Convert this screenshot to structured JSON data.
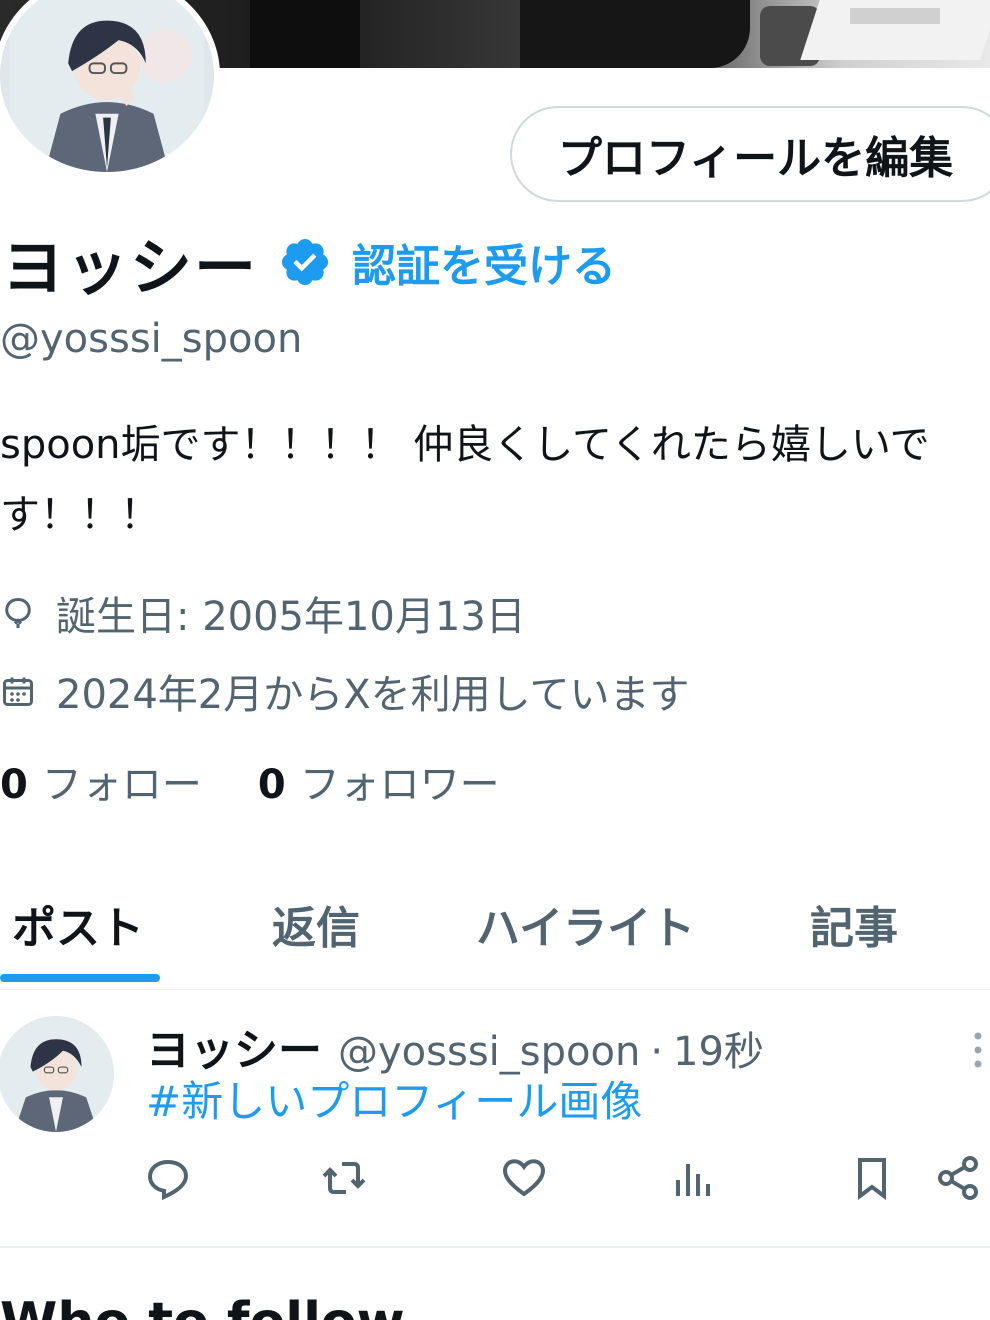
{
  "profile": {
    "display_name": "ヨッシー",
    "verify_link": "認証を受ける",
    "handle": "@yosssi_spoon",
    "bio": "spoon垢です！！！！ 仲良くしてくれたら嬉しいです！！！",
    "birthday": "誕生日: 2005年10月13日",
    "joined": "2024年2月からXを利用しています",
    "following_count": "0",
    "following_label": "フォロー",
    "followers_count": "0",
    "followers_label": "フォロワー",
    "edit_button": "プロフィールを編集"
  },
  "tabs": [
    {
      "label": "ポスト",
      "active": true
    },
    {
      "label": "返信",
      "active": false
    },
    {
      "label": "ハイライト",
      "active": false
    },
    {
      "label": "記事",
      "active": false
    }
  ],
  "post": {
    "name": "ヨッシー",
    "handle": "@yosssi_spoon",
    "separator": "·",
    "time": "19秒",
    "text": "#新しいプロフィール画像",
    "actions": [
      "reply-icon",
      "repost-icon",
      "like-icon",
      "views-icon",
      "bookmark-icon",
      "share-icon"
    ]
  },
  "section_heading": "Who to follow",
  "colors": {
    "accent": "#1d9bf0",
    "text_primary": "#0f1419",
    "text_secondary": "#536471"
  },
  "icons": {
    "verified": "verified-badge-icon",
    "birthday": "balloon-icon",
    "joined": "calendar-icon",
    "more": "more-vertical-icon"
  }
}
